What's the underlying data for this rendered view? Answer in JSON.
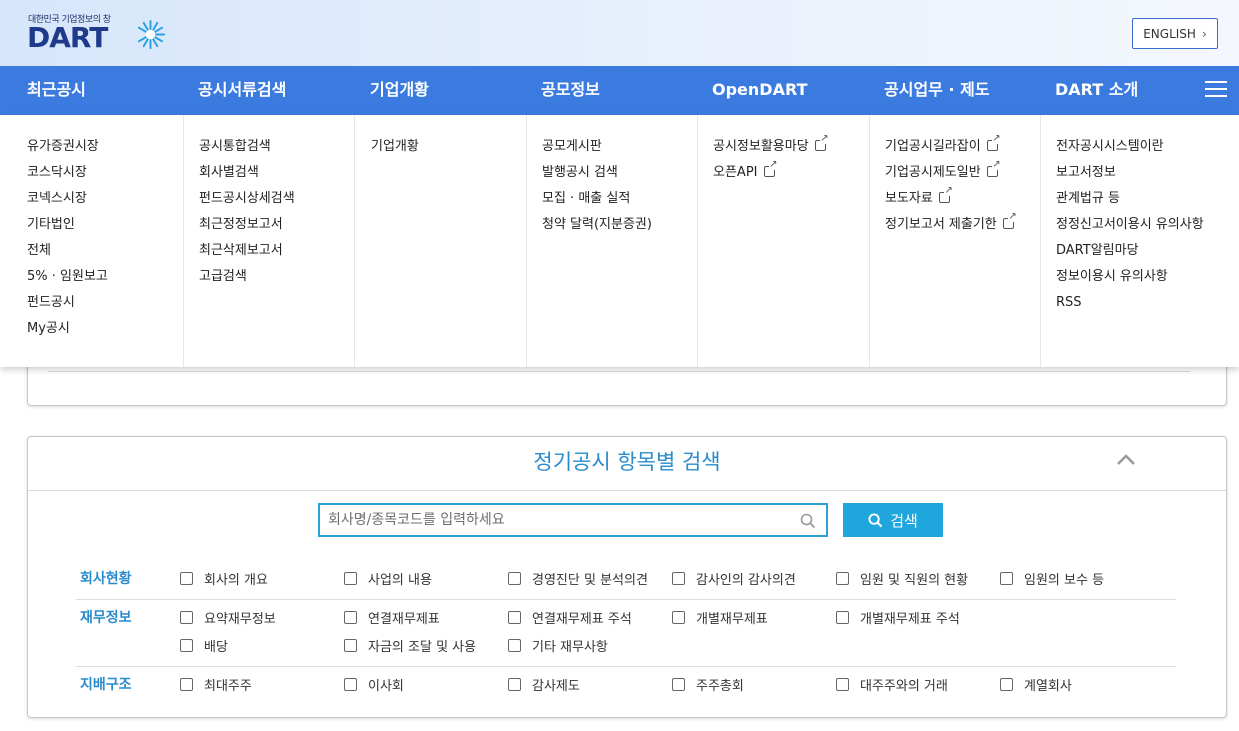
{
  "header": {
    "logo_subtitle": "대한민국 기업정보의 창",
    "logo_text": "DART",
    "english_button": "ENGLISH"
  },
  "nav": {
    "items": [
      "최근공시",
      "공시서류검색",
      "기업개황",
      "공모정보",
      "OpenDART",
      "공시업무 · 제도",
      "DART 소개"
    ]
  },
  "mega_menu": {
    "columns": [
      [
        "유가증권시장",
        "코스닥시장",
        "코넥스시장",
        "기타법인",
        "전체",
        "5% · 임원보고",
        "펀드공시",
        "My공시"
      ],
      [
        "공시통합검색",
        "회사별검색",
        "펀드공시상세검색",
        "최근정정보고서",
        "최근삭제보고서",
        "고급검색"
      ],
      [
        "기업개황"
      ],
      [
        "공모게시판",
        "발행공시 검색",
        "모집 · 매출 실적",
        "청약 달력(지분증권)"
      ],
      [
        "공시정보활용마당",
        "오픈API"
      ],
      [
        "기업공시길라잡이",
        "기업공시제도일반",
        "보도자료",
        "정기보고서 제출기한"
      ],
      [
        "전자공시시스템이란",
        "보고서정보",
        "관계법규 등",
        "정정신고서이용시 유의사항",
        "DART알림마당",
        "정보이용시 유의사항",
        "RSS"
      ]
    ]
  },
  "periodic_search": {
    "title": "정기공시 항목별 검색",
    "search_placeholder": "회사명/종목코드를 입력하세요",
    "search_button": "검색",
    "categories": [
      {
        "label": "회사현황",
        "options": [
          "회사의 개요",
          "사업의 내용",
          "경영진단 및 분석의견",
          "감사인의 감사의견",
          "임원 및 직원의 현황",
          "임원의 보수 등"
        ]
      },
      {
        "label": "재무정보",
        "options": [
          "요약재무정보",
          "연결재무제표",
          "연결재무제표 주석",
          "개별재무제표",
          "개별재무제표 주석",
          "배당",
          "자금의 조달 및 사용",
          "기타 재무사항"
        ]
      },
      {
        "label": "지배구조",
        "options": [
          "최대주주",
          "이사회",
          "감사제도",
          "주주총회",
          "대주주와의 거래",
          "계열회사"
        ]
      }
    ]
  },
  "colors": {
    "nav_bg": "#3b7be0",
    "accent": "#2a8ccd",
    "search_button": "#1fa6dc"
  }
}
